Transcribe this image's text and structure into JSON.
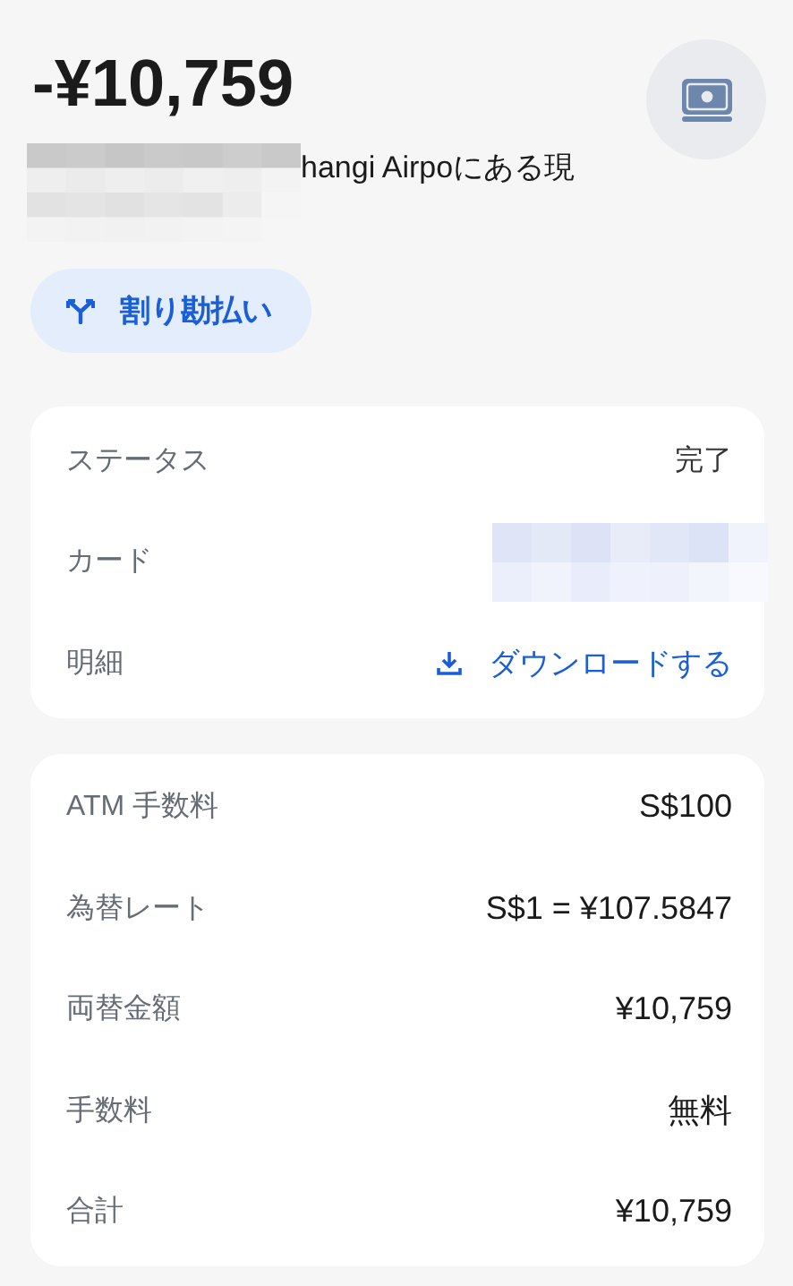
{
  "amount": "-¥10,759",
  "subtitle": "hangi Airpoにある現",
  "split_button": {
    "label": "割り勘払い"
  },
  "details": [
    {
      "label": "ステータス",
      "kind": "text",
      "value": "完了"
    },
    {
      "label": "カード",
      "kind": "redacted"
    },
    {
      "label": "明細",
      "kind": "link",
      "value": "ダウンロードする"
    }
  ],
  "breakdown": [
    {
      "label": "ATM 手数料",
      "value": "S$100"
    },
    {
      "label": "為替レート",
      "value": "S$1 = ¥107.5847"
    },
    {
      "label": "両替金額",
      "value": "¥10,759"
    },
    {
      "label": "手数料",
      "value": "無料"
    },
    {
      "label": "合計",
      "value": "¥10,759"
    }
  ]
}
